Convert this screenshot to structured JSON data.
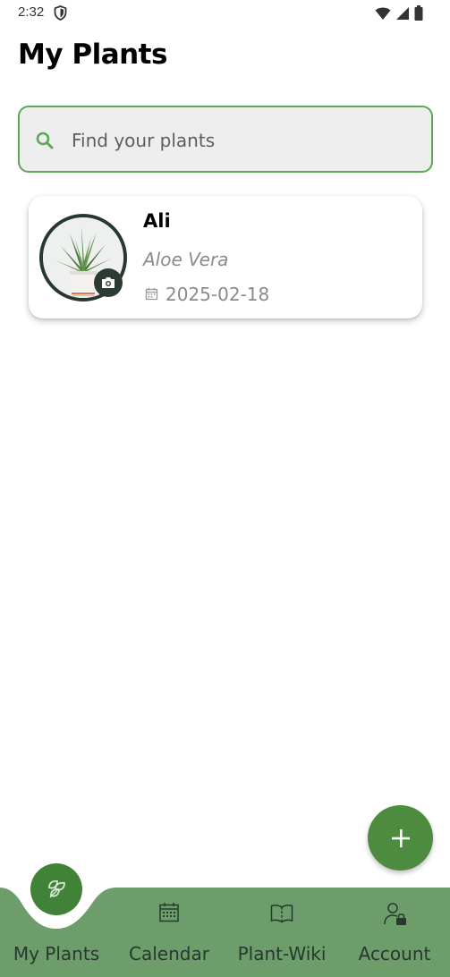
{
  "status_bar": {
    "time": "2:32",
    "icons": [
      "shield-icon",
      "wifi-icon",
      "signal-icon",
      "battery-icon"
    ]
  },
  "header": {
    "title": "My Plants"
  },
  "search": {
    "placeholder": "Find your plants",
    "value": ""
  },
  "plants": [
    {
      "name": "Ali",
      "species": "Aloe Vera",
      "date": "2025-02-18"
    }
  ],
  "fab": {
    "icon": "plus-icon"
  },
  "bottom_nav": {
    "items": [
      {
        "label": "My Plants",
        "icon": "plants-icon",
        "active": true
      },
      {
        "label": "Calendar",
        "icon": "calendar-icon",
        "active": false
      },
      {
        "label": "Plant-Wiki",
        "icon": "book-icon",
        "active": false
      },
      {
        "label": "Account",
        "icon": "account-icon",
        "active": false
      }
    ]
  },
  "colors": {
    "accent": "#4d8c3f",
    "nav_background": "#6c9d6a",
    "search_border": "#5fa55a",
    "dark": "#27382f"
  }
}
